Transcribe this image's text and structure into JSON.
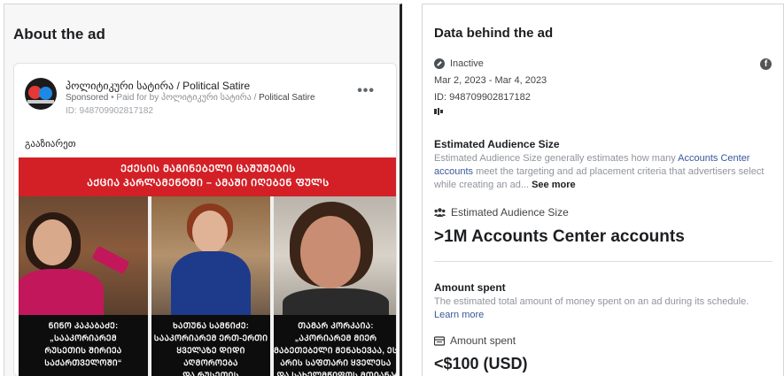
{
  "about": {
    "title": "About the ad",
    "page_name": "პოლიტიკური სატირა / Political Satire",
    "sponsored_label": "Sponsored",
    "paid_for_prefix": " • Paid for by პოლიტიკური სატირა / ",
    "paid_for_name": "Political Satire",
    "ad_id": "ID: 948709902817182",
    "more": "•••",
    "caption": "გააზიარეთ",
    "banner_line1": "ᲔᲥᲔᲡᲘᲡ ᲛᲐᲒᲘᲜᲔᲑᲔᲚᲘ ᲪᲐᲨᲣᲨᲔᲑᲘᲡ",
    "banner_line2": "ᲐᲥᲪᲘᲐ ᲞᲐᲠᲚᲐᲛᲔᲜᲢᲨᲘ – ᲐᲛᲐᲨᲘ ᲘᲦᲔᲑᲔᲜ ᲤᲣᲚᲡ",
    "quotes": [
      [
        "ᲜᲘᲜᲝ ᲙᲐᲙᲐᲑᲐᲫᲔ:",
        "„ᲡᲐᲐᲙᲝᲠᲘᲐᲠᲔᲛ",
        "ᲠᲣᲡᲔᲗᲘᲡ ᲨᲘᲠᲘᲔᲐ",
        "ᲡᲐᲥᲐᲠᲗᲕᲔᲚᲝᲨᲘ“"
      ],
      [
        "ᲮᲐᲗᲣᲜᲐ ᲡᲐᲛᲜᲘᲫᲔ:",
        "ᲡᲐᲐᲙᲝᲠᲘᲐᲠᲔᲛ ᲔᲠᲗ-ᲔᲠᲗᲘ",
        "ᲧᲕᲔᲚᲐᲖᲔ ᲓᲘᲓᲘ ᲐᲦᲛᲝᲠᲝᲔᲑᲐ",
        "ᲓᲐ ᲠᲣᲡᲔᲗᲘᲡ ᲒᲐᲛᲠᲫᲔᲚᲔᲑᲐᲐ"
      ],
      [
        "ᲗᲐᲛᲐᲠ ᲙᲝᲠᲙᲐᲘᲐ:",
        "„ᲐᲙᲝᲠᲘᲐᲠᲔᲛ ᲛᲘᲔᲠ",
        "ᲛᲐᲑᲔᲗᲔᲑᲔᲚᲘ ᲛᲔᲜᲐᲮᲔᲕᲐᲐ, ᲔᲡ",
        "ᲐᲠᲘᲡ ᲡᲐᲤᲗᲐᲠᲘ ᲧᲕᲔᲚᲔᲡᲐ"
      ],
      [],
      []
    ],
    "quote3_line5": "ᲓᲐ ᲡᲐᲮᲔᲚᲛᲬᲘᲤᲝᲡ ᲛᲗᲘᲐᲜᲐ"
  },
  "data_behind": {
    "title": "Data behind the ad",
    "status": "Inactive",
    "fb_icon": "f",
    "date_range": "Mar 2, 2023 - Mar 4, 2023",
    "ad_id": "ID: 948709902817182",
    "platform_icon": "platform-icon",
    "est_heading": "Estimated Audience Size",
    "est_desc_1": "Estimated Audience Size generally estimates how many ",
    "est_desc_link": "Accounts Center accounts",
    "est_desc_2": " meet the targeting and ad placement criteria that advertisers select while creating an ad...",
    "see_more": " See more",
    "est_label": "Estimated Audience Size",
    "est_value": ">1M Accounts Center accounts",
    "amount_heading": "Amount spent",
    "amount_desc": "The estimated total amount of money spent on an ad during its schedule.",
    "learn_more": "Learn more",
    "amount_label": "Amount spent",
    "amount_value": "<$100 (USD)"
  }
}
